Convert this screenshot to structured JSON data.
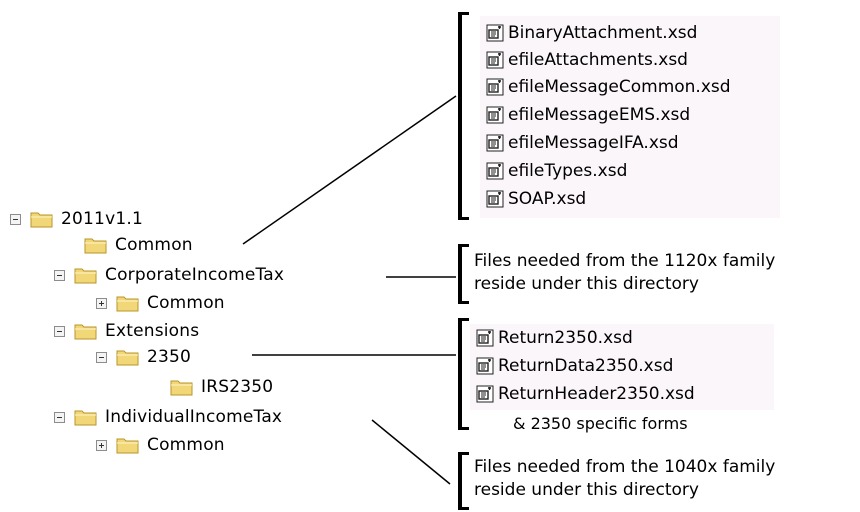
{
  "tree": {
    "root": "2011v1.1",
    "common": "Common",
    "corporate": "CorporateIncomeTax",
    "corporate_common": "Common",
    "extensions": "Extensions",
    "ext_2350": "2350",
    "irs2350": "IRS2350",
    "individual": "IndividualIncomeTax",
    "individual_common": "Common"
  },
  "common_files": [
    "BinaryAttachment.xsd",
    "efileAttachments.xsd",
    "efileMessageCommon.xsd",
    "efileMessageEMS.xsd",
    "efileMessageIFA.xsd",
    "efileTypes.xsd",
    "SOAP.xsd"
  ],
  "form2350_files": [
    "Return2350.xsd",
    "ReturnData2350.xsd",
    "ReturnHeader2350.xsd"
  ],
  "form2350_note": "& 2350 specific forms",
  "note_1120": {
    "line1": "Files needed from the 1120x family",
    "line2": "reside under this directory"
  },
  "note_1040": {
    "line1": "Files needed from the 1040x family",
    "line2": "reside under this directory"
  },
  "colors": {
    "folder_fill": "#f2d778",
    "folder_stroke": "#b8952a",
    "panel_bg": "#fbf6fa"
  }
}
